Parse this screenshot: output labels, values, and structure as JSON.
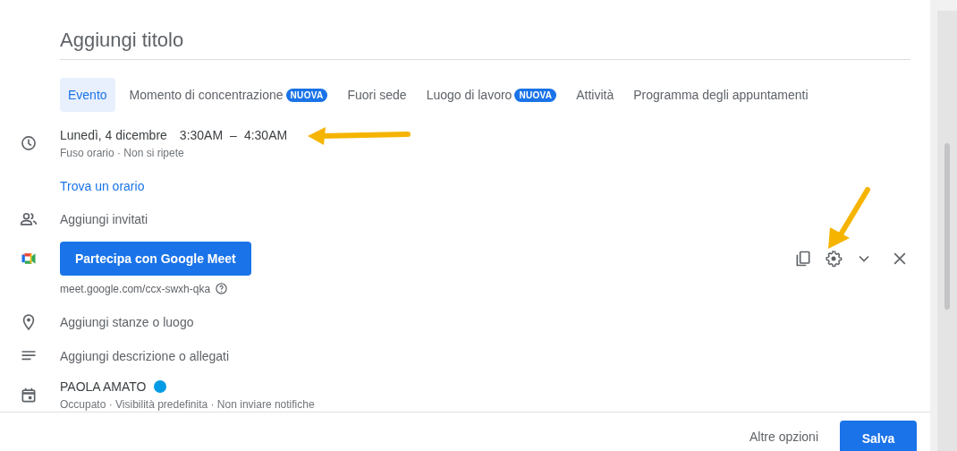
{
  "title_field": {
    "placeholder": "Aggiungi titolo"
  },
  "tabs": [
    {
      "label": "Evento",
      "selected": true
    },
    {
      "label": "Momento di concentrazione",
      "badge": "NUOVA",
      "selected": false
    },
    {
      "label": "Fuori sede",
      "selected": false
    },
    {
      "label": "Luogo di lavoro",
      "badge": "NUOVA",
      "selected": false
    },
    {
      "label": "Attività",
      "selected": false
    },
    {
      "label": "Programma degli appuntamenti",
      "selected": false
    }
  ],
  "rows": [
    {
      "kind": "datetime",
      "date": "Lunedì, 4 dicembre",
      "start": "3:30AM",
      "separator": "–",
      "end": "4:30AM",
      "details": "Fuso orario · Non si ripete"
    },
    {
      "kind": "link",
      "text": "Trova un orario"
    },
    {
      "kind": "guests",
      "placeholder": "Aggiungi invitati"
    },
    {
      "kind": "meet",
      "button": "Partecipa con Google Meet",
      "url": "meet.google.com/ccx-swxh-qka"
    },
    {
      "kind": "location",
      "placeholder": "Aggiungi stanze o luogo"
    },
    {
      "kind": "description",
      "placeholder": "Aggiungi descrizione o allegati"
    },
    {
      "kind": "calendar",
      "owner": "PAOLA AMATO",
      "color": "#039be5",
      "details": "Occupato · Visibilità predefinita · Non inviare notifiche"
    }
  ],
  "footer": {
    "more_options": "Altre opzioni",
    "save": "Salva"
  }
}
